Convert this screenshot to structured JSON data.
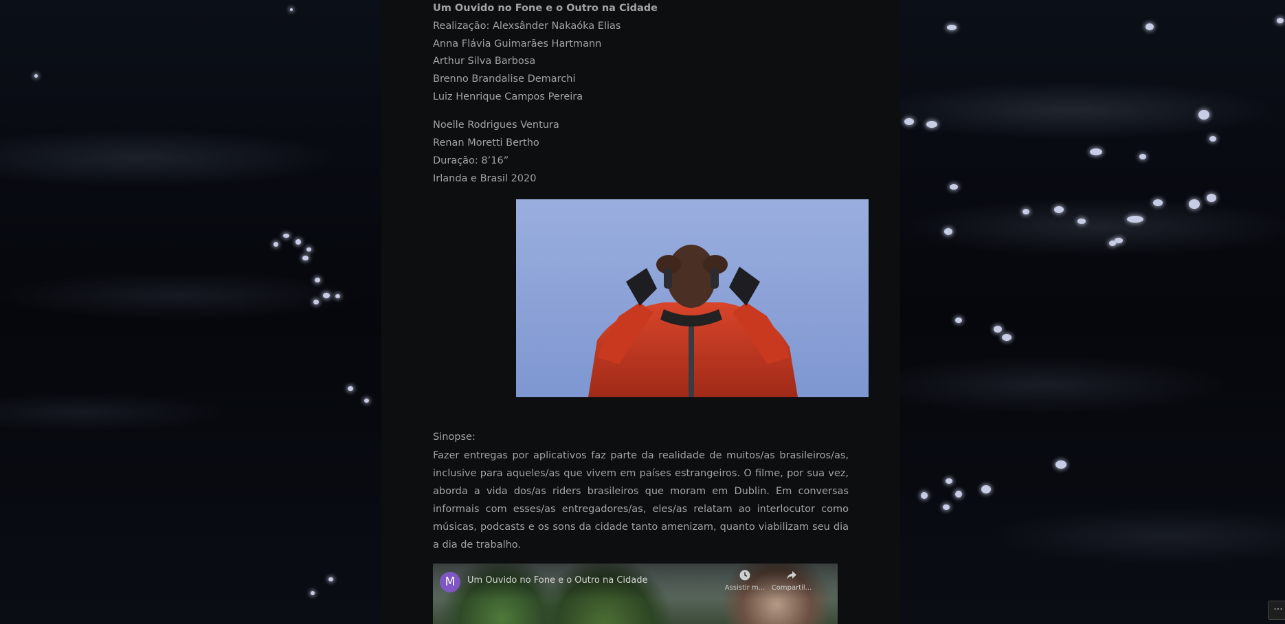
{
  "credits": {
    "title": "Um Ouvido no Fone e o Outro na Cidade",
    "lines_group1": [
      "Realização: Alexsânder Nakaóka Elias",
      "Anna Flávia Guimarães Hartmann",
      "Arthur Silva Barbosa",
      "Brenno Brandalise Demarchi",
      "Luiz Henrique Campos Pereira"
    ],
    "lines_group2": [
      "Noelle Rodrigues Ventura",
      "Renan Moretti Bertho",
      "Duração: 8’16”",
      "Irlanda e Brasil 2020"
    ]
  },
  "sinopse": {
    "label": "Sinopse:",
    "text": "Fazer entregas por aplicativos faz parte da realidade de muitos/as brasileiros/as, inclusive para aqueles/as que vivem em países estrangeiros. O filme, por sua vez, aborda a vida dos/as riders brasileiros que moram em Dublin. Em conversas informais com esses/as entregadores/as, eles/as relatam ao interlocutor como músicas, podcasts e os sons da cidade tanto amenizam, quanto viabilizam seu dia a dia de trabalho."
  },
  "video": {
    "channel_initial": "M",
    "title": "Um Ouvido no Fone e o Outro na Cidade",
    "watch_later_label": "Assistir m...",
    "share_label": "Compartil..."
  },
  "icons": {
    "watch_later": "clock-icon",
    "share": "share-icon",
    "more": "ellipsis-icon"
  },
  "more_button": {
    "label": "···"
  }
}
